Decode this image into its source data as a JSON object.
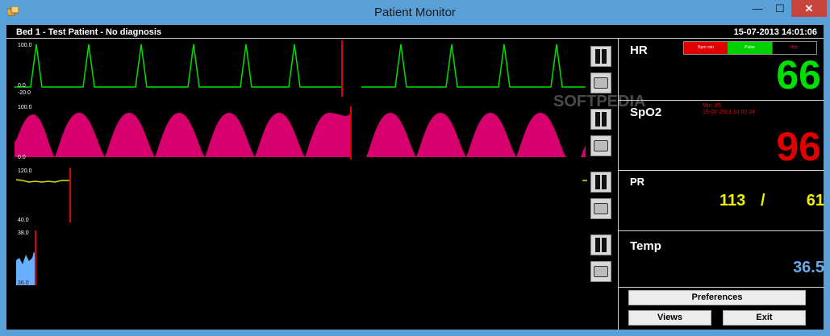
{
  "window": {
    "title": "Patient Monitor",
    "min_glyph": "—",
    "max_glyph": "☐",
    "close_glyph": "✕"
  },
  "header": {
    "bed_info": "Bed 1 - Test Patient - No diagnosis",
    "datetime": "15-07-2013 14:01:06"
  },
  "waveforms": [
    {
      "name": "hr-wave",
      "color": "#00e000",
      "top_label": "100.0",
      "bottom_label": "0.0",
      "extra_label": "-20.0"
    },
    {
      "name": "spo2-wave",
      "color": "#d8006e",
      "top_label": "100.0",
      "bottom_label": "0.0"
    },
    {
      "name": "pr-wave",
      "color": "#e0e000",
      "top_label": "120.0",
      "bottom_label": "40.0"
    },
    {
      "name": "temp-wave",
      "color": "#66b0ff",
      "top_label": "38.0",
      "bottom_label": "36.0"
    }
  ],
  "panels": {
    "hr": {
      "label": "HR",
      "value": "66",
      "value_color": "#00e000",
      "alarm_bar": [
        {
          "text": "Bpm min",
          "color": "#e00000"
        },
        {
          "text": "Pulse",
          "color": "#00d000"
        },
        {
          "text": "High",
          "color": "#b00060"
        }
      ]
    },
    "spo2": {
      "label": "SpO2",
      "value": "96",
      "value_color": "#e00000",
      "min_label": "Min:  85",
      "min_time": "15-07-2013 14:00:24"
    },
    "pr": {
      "label": "PR",
      "value_a": "113",
      "separator": "/",
      "value_b": "61",
      "value_color": "#f0f000"
    },
    "temp": {
      "label": "Temp",
      "value": "36.5",
      "value_color": "#6aa8e8"
    }
  },
  "buttons": {
    "preferences": "Preferences",
    "views": "Views",
    "exit": "Exit"
  },
  "watermark": {
    "text": "SOFTPEDIA"
  }
}
